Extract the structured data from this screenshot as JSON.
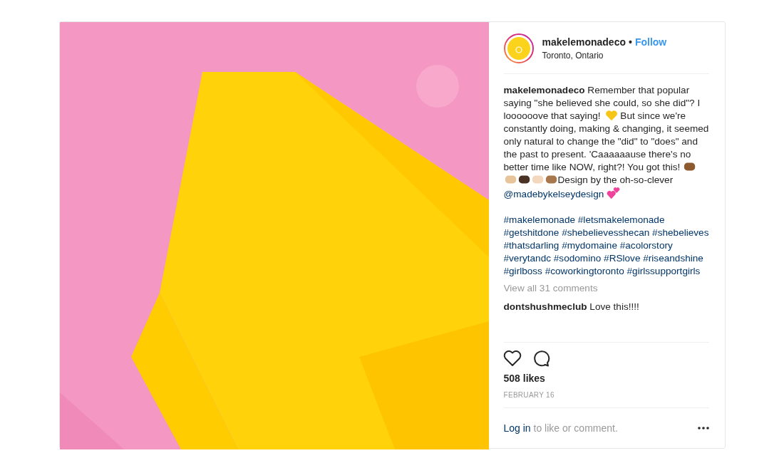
{
  "post": {
    "author": {
      "username": "makelemonadeco",
      "separator": "•",
      "follow": "Follow",
      "location": "Toronto, Ontario"
    },
    "caption": [
      {
        "kind": "text",
        "text": "**makelemonadeco** Remember that popular saying \"she believed she could, so she did\"? I loooooove that saying!"
      },
      {
        "kind": "heart",
        "color": "#f5c518"
      },
      {
        "kind": "text",
        "text": "But since we're constantly doing, making & changing, it seemed only natural to change the \"did\" to \"does\" and the past to present. 'Caaaaaause there's no better time like NOW, right?! You got this!"
      },
      {
        "kind": "fist",
        "color": "#8d5a2f"
      },
      {
        "kind": "fist",
        "color": "#e8c49a"
      },
      {
        "kind": "fist",
        "color": "#4a3222"
      },
      {
        "kind": "fist",
        "color": "#f3d8bd"
      },
      {
        "kind": "fist",
        "color": "#a8774c"
      },
      {
        "kind": "text",
        "text": "Design by the oh-so-clever"
      },
      {
        "kind": "mention",
        "text": "@madebykelseydesign"
      },
      {
        "kind": "hearts",
        "color": "#f0439c"
      }
    ],
    "hashtags": [
      "#makelemonade",
      "#letsmakelemonade",
      "#getshitdone",
      "#shebelievesshecan",
      "#shebelieves",
      "#thatsdarling",
      "#mydomaine",
      "#acolorstory",
      "#verytandc",
      "#sodomino",
      "#RSlove",
      "#riseandshine",
      "#girlboss",
      "#coworkingtoronto",
      "#girlssupportgirls"
    ],
    "view_comments": "View all 31 comments",
    "comments": [
      {
        "username": "dontshushmeclub",
        "text": "Love this!!!!"
      }
    ],
    "likes": "508 likes",
    "date": "FEBRUARY 16",
    "login": {
      "link": "Log in",
      "text": "to like or comment."
    }
  }
}
